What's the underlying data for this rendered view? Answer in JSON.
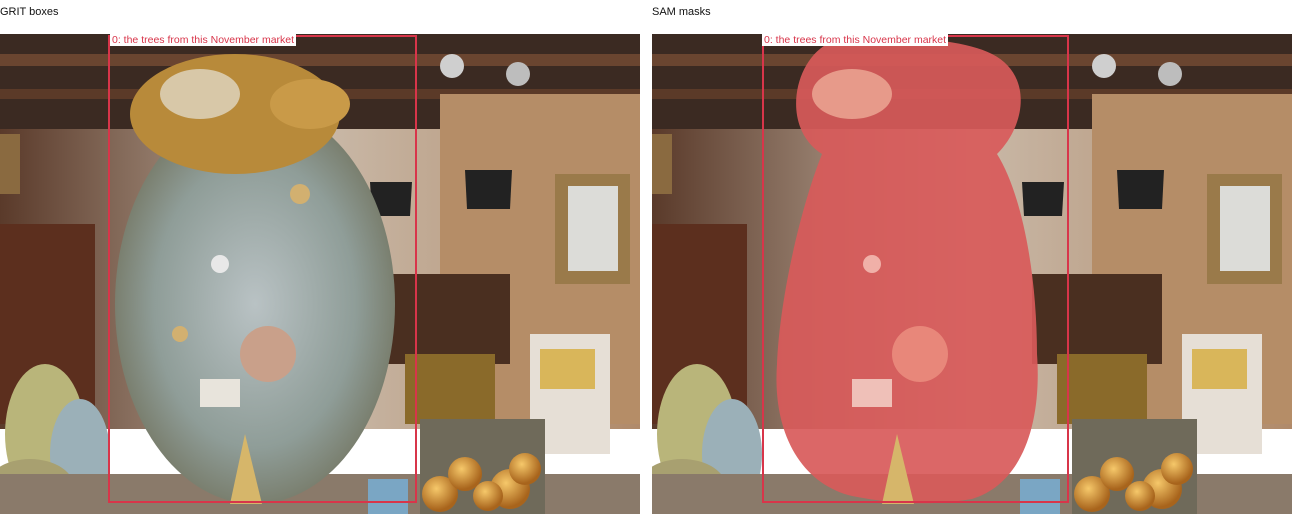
{
  "panels": [
    {
      "title": "GRIT boxes"
    },
    {
      "title": "SAM masks"
    }
  ],
  "detection": {
    "label": "0: the trees from this November market",
    "box_color": "#d8354a",
    "mask_color": "#e05060"
  }
}
